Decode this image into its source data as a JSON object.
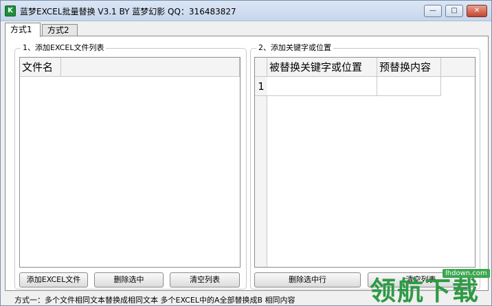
{
  "window": {
    "title": "蓝梦EXCEL批量替换 V3.1 BY 蓝梦幻影 QQ：316483827",
    "icon_label": "K"
  },
  "tabs": [
    {
      "label": "方式1",
      "active": true
    },
    {
      "label": "方式2",
      "active": false
    }
  ],
  "left_panel": {
    "title": "1、添加EXCEL文件列表",
    "columns": [
      "文件名"
    ],
    "buttons": {
      "add": "添加EXCEL文件",
      "delete": "删除选中",
      "clear": "清空列表"
    }
  },
  "right_panel": {
    "title": "2、添加关键字或位置",
    "columns": [
      "被替换关键字或位置",
      "预替换内容"
    ],
    "rows": [
      {
        "num": "1",
        "keyword": "",
        "replacement": ""
      }
    ],
    "buttons": {
      "delete_row": "删除选中行",
      "clear": "清空列表"
    }
  },
  "status_text": "方式一：多个文件相同文本替换成相同文本  多个EXCEL中的A全部替换成B 相同内容",
  "watermark": {
    "text": "领航下载",
    "url": "lhdown.com"
  },
  "colors": {
    "title_bar": "#c6d6ec",
    "close_button": "#c4452d",
    "watermark_green": "#2e9a45"
  }
}
